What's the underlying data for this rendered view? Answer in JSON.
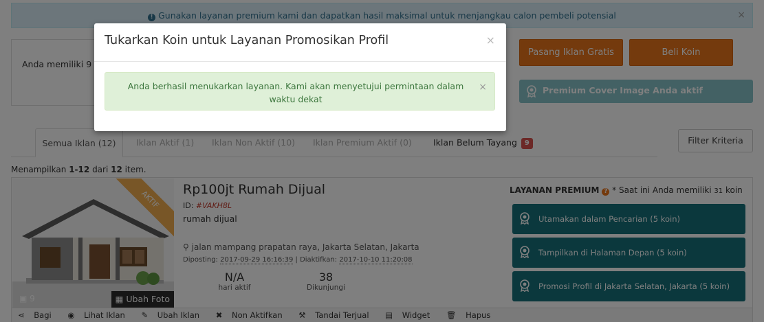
{
  "top_alert": {
    "text": "Gunakan layanan premium kami dan dapatkan hasil maksimal untuk menjangkau calon pembeli potensial",
    "close": "×"
  },
  "coin_panel": {
    "text": "Anda memiliki 9"
  },
  "buttons": {
    "pasang": "Pasang Iklan Gratis",
    "beli": "Beli Koin"
  },
  "premium_active": "Premium Cover Image Anda aktif",
  "tabs": [
    {
      "label": "Semua Iklan (12)"
    },
    {
      "label": "Iklan Aktif (1)"
    },
    {
      "label": "Iklan Non Aktif (10)"
    },
    {
      "label": "Iklan Premium Aktif (0)"
    },
    {
      "label": "Iklan Belum Tayang",
      "badge": "9"
    }
  ],
  "filter": "Filter Kriteria",
  "showing": {
    "prefix": "Menampilkan",
    "range": "1-12",
    "mid": "dari",
    "total": "12",
    "suffix": "item."
  },
  "listing": {
    "ribbon": "AKTIF",
    "photo_count": "9",
    "ubah_foto": "Ubah Foto",
    "price_title": "Rp100jt Rumah Dijual",
    "id_label": "ID:",
    "id_value": "#VAKH8L",
    "description": "rumah dijual",
    "location": "jalan mampang prapatan raya, Jakarta Selatan, Jakarta",
    "posted_label": "Diposting:",
    "posted_value": "2017-09-29 16:16:39",
    "activated_label": "Diaktifkan:",
    "activated_value": "2017-10-10 11:20:08",
    "stats": [
      {
        "value": "N/A",
        "label": "hari aktif"
      },
      {
        "value": "38",
        "label": "Dikunjungi"
      }
    ],
    "premium": {
      "title": "LAYANAN PREMIUM",
      "note_prefix": "* Saat ini Anda memiliki",
      "coins": "31",
      "note_suffix": "koin",
      "services": [
        "Utamakan dalam Pencarian (5 koin)",
        "Tampilkan di Halaman Depan (5 koin)",
        "Promosi Profil di Jakarta Selatan, Jakarta (5 koin)"
      ]
    },
    "actions": [
      "Bagi",
      "Lihat Iklan",
      "Ubah Iklan",
      "Non Aktifkan",
      "Tandai Terjual",
      "Widget",
      "Hapus"
    ]
  },
  "modal": {
    "title": "Tukarkan Koin untuk Layanan Promosikan Profil",
    "close": "×",
    "success": "Anda berhasil menukarkan layanan. Kami akan menyetujui permintaan dalam waktu dekat",
    "success_close": "×"
  }
}
